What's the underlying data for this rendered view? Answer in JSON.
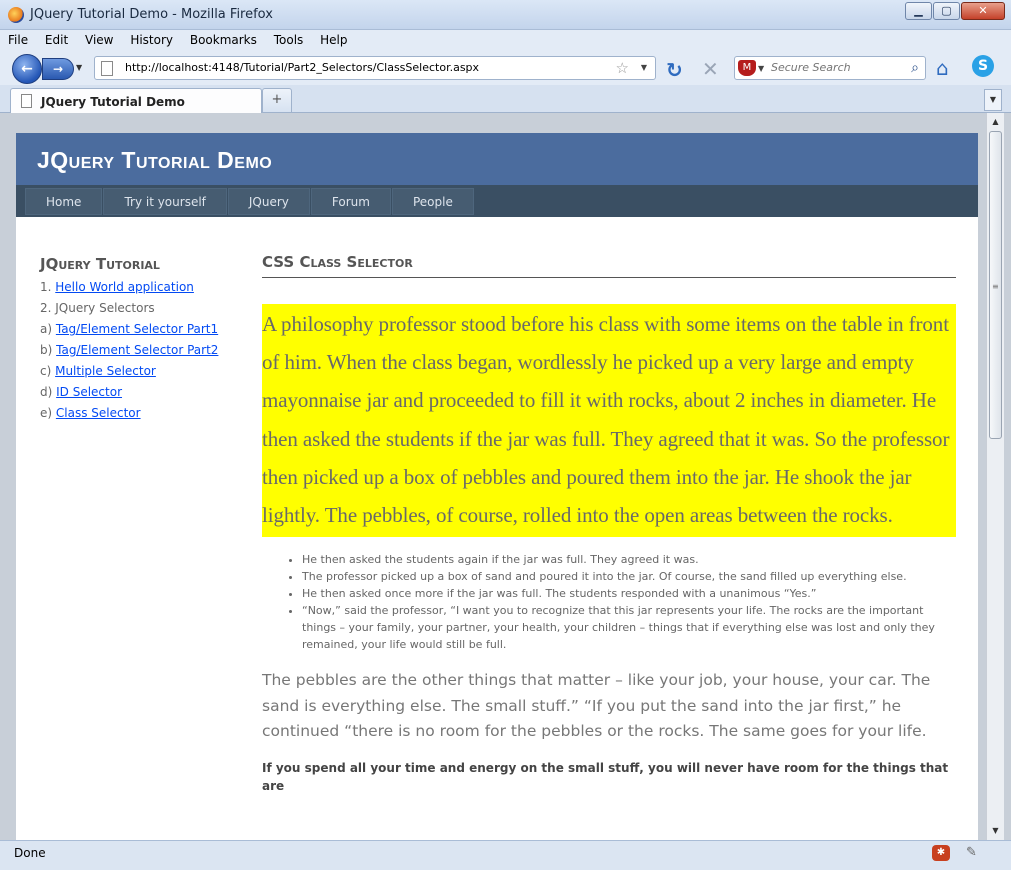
{
  "window": {
    "title": "JQuery Tutorial Demo - Mozilla Firefox",
    "buttons": [
      "0",
      "1",
      "r"
    ]
  },
  "menu": [
    "File",
    "Edit",
    "View",
    "History",
    "Bookmarks",
    "Tools",
    "Help"
  ],
  "nav": {
    "back": "←",
    "forward": "→",
    "url": "http://localhost:4148/Tutorial/Part2_Selectors/ClassSelector.aspx",
    "search_placeholder": "Secure Search"
  },
  "tabs": [
    {
      "label": "JQuery Tutorial Demo"
    }
  ],
  "site": {
    "title": "JQuery Tutorial Demo",
    "nav": [
      "Home",
      "Try it yourself",
      "JQuery",
      "Forum",
      "People"
    ]
  },
  "sidebar": {
    "heading": "JQuery Tutorial",
    "items": [
      {
        "prefix": "1. ",
        "link": "Hello World application"
      },
      {
        "prefix": "2. JQuery Selectors",
        "link": ""
      },
      {
        "prefix": "a) ",
        "link": "Tag/Element Selector Part1"
      },
      {
        "prefix": "b) ",
        "link": "Tag/Element Selector Part2"
      },
      {
        "prefix": "c) ",
        "link": "Multiple Selector"
      },
      {
        "prefix": "d) ",
        "link": "ID Selector"
      },
      {
        "prefix": "e) ",
        "link": "Class Selector"
      }
    ]
  },
  "main": {
    "heading": "CSS Class Selector",
    "highlight": "A philosophy professor stood before his class with some items on the table in front of him. When the class began, wordlessly he picked up a very large and empty mayonnaise jar and proceeded to fill it with rocks, about 2 inches in diameter. He then asked the students if the jar was full. They agreed that it was. So the professor then picked up a box of pebbles and poured them into the jar. He shook the jar lightly. The pebbles, of course, rolled into the open areas between the rocks.",
    "bullets": [
      "He then asked the students again if the jar was full. They agreed it was.",
      "The professor picked up a box of sand and poured it into the jar. Of course, the sand filled up everything else.",
      "He then asked once more if the jar was full. The students responded with a unanimous “Yes.”",
      "“Now,” said the professor, “I want you to recognize that this jar represents your life. The rocks are the important things – your family, your partner, your health, your children – things that if everything else was lost and only they remained, your life would still be full."
    ],
    "paragraph": "The pebbles are the other things that matter – like your job, your house, your car. The sand is everything else. The small stuff.” “If you put the sand into the jar first,” he continued “there is no room for the pebbles or the rocks. The same goes for your life.",
    "bold_paragraph": "If you spend all your time and energy on the small stuff, you will never have room for the things that are"
  },
  "status": {
    "text": "Done"
  }
}
